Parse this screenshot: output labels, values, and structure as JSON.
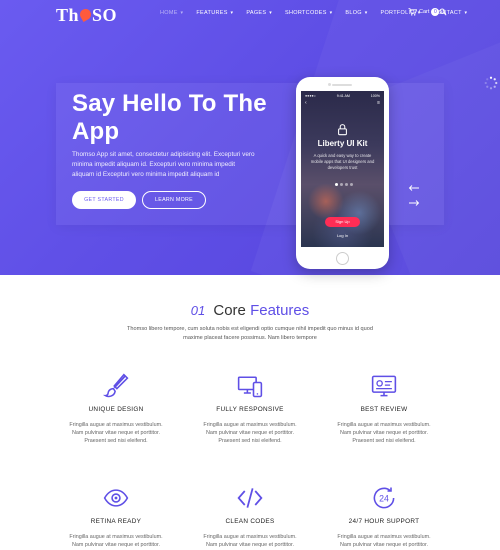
{
  "brand": {
    "logo_left": "Th",
    "logo_right": "SO",
    "accent": "#5f4fe6",
    "logo_mark_color": "#ff5a3c"
  },
  "nav": {
    "items": [
      {
        "label": "HOME",
        "caret": "▾",
        "active": true
      },
      {
        "label": "FEATURES",
        "caret": "▾"
      },
      {
        "label": "PAGES",
        "caret": "▾"
      },
      {
        "label": "SHORTCODES",
        "caret": "▾"
      },
      {
        "label": "BLOG",
        "caret": "▾"
      },
      {
        "label": "PORTFOLIO",
        "caret": "▾"
      },
      {
        "label": "CONTACT",
        "caret": "▾"
      }
    ],
    "cart_label": "Cart",
    "cart_count": "0",
    "search_icon": "search-icon"
  },
  "hero": {
    "title": "Say Hello To The App",
    "text": "Thomso App sit amet, consectetur adipisicing elit. Excepturi vero minima impedit aliquam id. Excepturi vero minima impedit aliquam id Excepturi vero minima impedit aliquam id",
    "primary_button": "GET STARTED",
    "secondary_button": "LEARN MORE"
  },
  "phone": {
    "carrier": "●●●●○",
    "time": "9:41 AM",
    "battery": "100%",
    "app_title": "Liberty UI Kit",
    "app_desc": "A quick and easy way to create mobile apps that UI designers and developers trust",
    "signup": "Sign Up",
    "login": "Log In"
  },
  "features": {
    "number": "01",
    "title_plain": "Core",
    "title_highlight": "Features",
    "subtitle": "Thomso libero tempore, cum soluta nobis est eligendi optio cumque nihil impedit quo minus id quod maxime placeat facere possimus. Nam libero tempore",
    "items": [
      {
        "title": "UNIQUE DESIGN",
        "icon": "brush-icon",
        "text": "Fringilla augue at maximus vestibulum. Nam pulvinar vitae neque et porttitor. Praesent sed nisi eleifend."
      },
      {
        "title": "FULLY RESPONSIVE",
        "icon": "devices-icon",
        "text": "Fringilla augue at maximus vestibulum. Nam pulvinar vitae neque et porttitor. Praesent sed nisi eleifend."
      },
      {
        "title": "BEST REVIEW",
        "icon": "review-icon",
        "text": "Fringilla augue at maximus vestibulum. Nam pulvinar vitae neque et porttitor. Praesent sed nisi eleifend."
      },
      {
        "title": "RETINA READY",
        "icon": "eye-icon",
        "text": "Fringilla augue at maximus vestibulum. Nam pulvinar vitae neque et porttitor. Praesent sed nisi eleifend."
      },
      {
        "title": "CLEAN CODES",
        "icon": "code-icon",
        "text": "Fringilla augue at maximus vestibulum. Nam pulvinar vitae neque et porttitor. Praesent sed nisi eleifend."
      },
      {
        "title": "24/7 HOUR SUPPORT",
        "icon": "support-24-icon",
        "text": "Fringilla augue at maximus vestibulum. Nam pulvinar vitae neque et porttitor. Praesent sed nisi eleifend."
      }
    ]
  }
}
